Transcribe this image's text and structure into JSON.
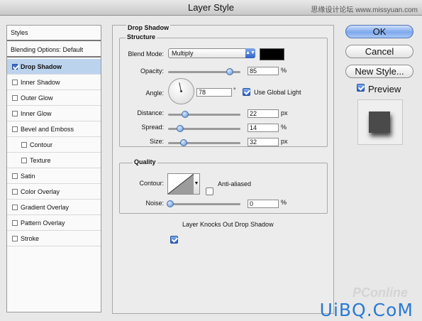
{
  "window": {
    "title": "Layer Style",
    "watermark_top": "思缘设计论坛 www.missyuan.com"
  },
  "left_list": {
    "header": "Styles",
    "blending": "Blending Options: Default",
    "items": [
      {
        "label": "Drop Shadow",
        "checked": true,
        "selected": true,
        "sub": false
      },
      {
        "label": "Inner Shadow",
        "checked": false,
        "selected": false,
        "sub": false
      },
      {
        "label": "Outer Glow",
        "checked": false,
        "selected": false,
        "sub": false
      },
      {
        "label": "Inner Glow",
        "checked": false,
        "selected": false,
        "sub": false
      },
      {
        "label": "Bevel and Emboss",
        "checked": false,
        "selected": false,
        "sub": false
      },
      {
        "label": "Contour",
        "checked": false,
        "selected": false,
        "sub": true
      },
      {
        "label": "Texture",
        "checked": false,
        "selected": false,
        "sub": true
      },
      {
        "label": "Satin",
        "checked": false,
        "selected": false,
        "sub": false
      },
      {
        "label": "Color Overlay",
        "checked": false,
        "selected": false,
        "sub": false
      },
      {
        "label": "Gradient Overlay",
        "checked": false,
        "selected": false,
        "sub": false
      },
      {
        "label": "Pattern Overlay",
        "checked": false,
        "selected": false,
        "sub": false
      },
      {
        "label": "Stroke",
        "checked": false,
        "selected": false,
        "sub": false
      }
    ]
  },
  "drop_shadow": {
    "title": "Drop Shadow",
    "structure": {
      "title": "Structure",
      "blend_mode_label": "Blend Mode:",
      "blend_mode_value": "Multiply",
      "shadow_color": "#000000",
      "opacity_label": "Opacity:",
      "opacity_value": "85",
      "opacity_unit": "%",
      "opacity_level": 0.85,
      "angle_label": "Angle:",
      "angle_value": "78",
      "angle_unit": "°",
      "use_global_light_label": "Use Global Light",
      "use_global_light": true,
      "distance_label": "Distance:",
      "distance_value": "22",
      "distance_unit": "px",
      "spread_label": "Spread:",
      "spread_value": "14",
      "spread_unit": "%",
      "size_label": "Size:",
      "size_value": "32",
      "size_unit": "px"
    },
    "quality": {
      "title": "Quality",
      "contour_label": "Contour:",
      "anti_aliased_label": "Anti-aliased",
      "anti_aliased": false,
      "noise_label": "Noise:",
      "noise_value": "0",
      "noise_unit": "%"
    },
    "knockout_label": "Layer Knocks Out Drop Shadow",
    "knockout": true
  },
  "buttons": {
    "ok": "OK",
    "cancel": "Cancel",
    "new_style": "New Style...",
    "preview_label": "Preview",
    "preview": true
  },
  "watermarks": {
    "pconline": "PConline",
    "uibq": "UiBQ.CoM"
  }
}
